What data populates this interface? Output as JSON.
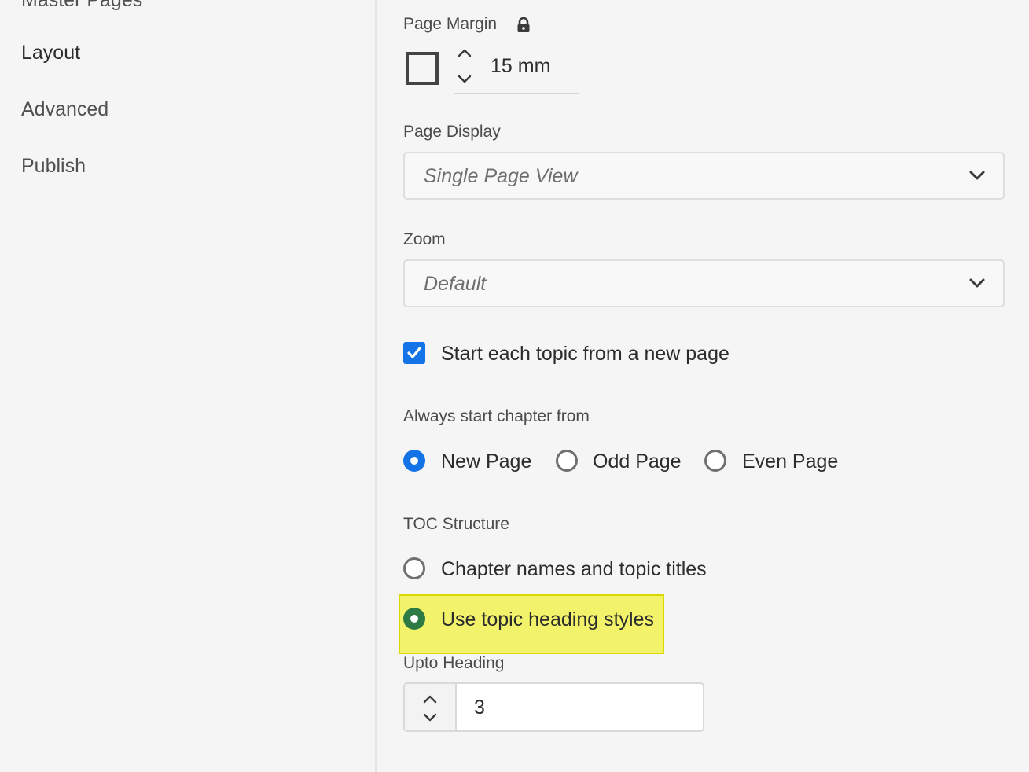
{
  "sidebar": {
    "items": [
      {
        "label": "Master Pages"
      },
      {
        "label": "Layout"
      },
      {
        "label": "Advanced"
      },
      {
        "label": "Publish"
      }
    ]
  },
  "page_margin": {
    "label": "Page Margin",
    "value": "15 mm",
    "locked": true
  },
  "page_display": {
    "label": "Page Display",
    "value": "Single Page View"
  },
  "zoom": {
    "label": "Zoom",
    "value": "Default"
  },
  "start_topic_new_page": {
    "label": "Start each topic from a new page",
    "checked": true
  },
  "chapter_start": {
    "label": "Always start chapter from",
    "options": [
      {
        "label": "New Page",
        "selected": true
      },
      {
        "label": "Odd Page",
        "selected": false
      },
      {
        "label": "Even Page",
        "selected": false
      }
    ]
  },
  "toc_structure": {
    "label": "TOC Structure",
    "options": [
      {
        "label": "Chapter names and topic titles",
        "selected": false
      },
      {
        "label": "Use topic heading styles",
        "selected": true
      }
    ]
  },
  "upto_heading": {
    "label": "Upto Heading",
    "value": "3"
  },
  "colors": {
    "accent": "#1473e6",
    "highlight": "#f2f36a",
    "selected_green": "#2d7a44"
  }
}
